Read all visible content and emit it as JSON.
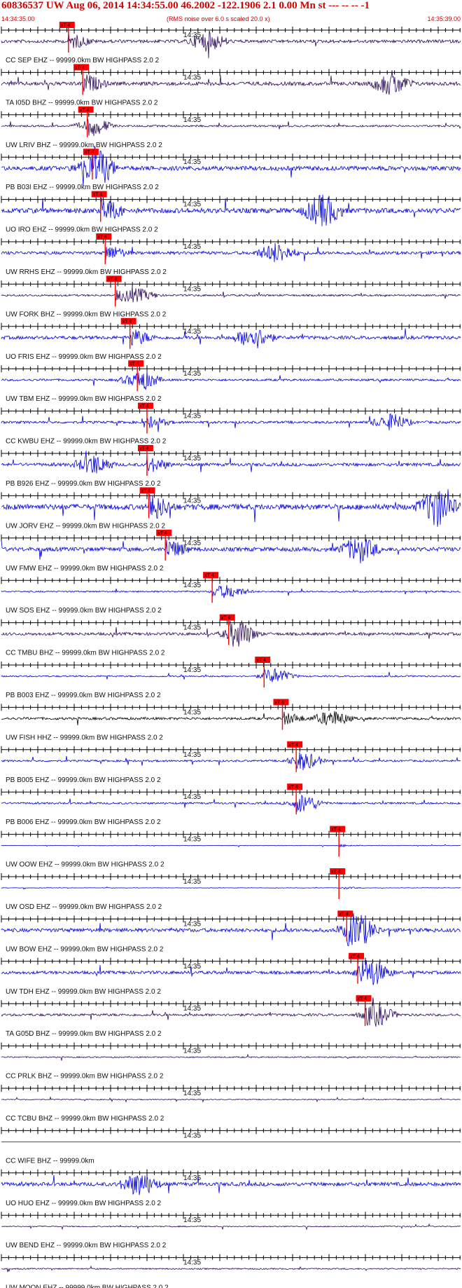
{
  "header": {
    "title": "60836537 UW Aug 06, 2014 14:34:55.00   46.2002 -122.1906  2.1 0.00 Mn st --- -- --  -1",
    "start_time": "14:34:35.00",
    "scale_note": "(RMS noise over 6.0 s scaled 20.0 x)",
    "end_time": "14:35:39.00"
  },
  "colors": {
    "header_red": "#d40000",
    "trace_blue": "#0000e0",
    "trace_dark": "#2a0a5a",
    "trace_black": "#000000",
    "pick_red": "#ff0000",
    "axis_black": "#000000"
  },
  "time_label": "14:35",
  "pick_label": "xT 4",
  "traces": [
    {
      "label": "CC SEP EHZ -- 99999.0km BW  HIGHPASS  2.0  2",
      "color": "dark",
      "pick": 0.146,
      "burst": 0.45,
      "amp": 1.0
    },
    {
      "label": "TA I05D BHZ -- 99999.0km BW  HIGHPASS  2.0  2",
      "color": "dark",
      "pick": 0.177,
      "burst": 0.85,
      "amp": 1.2
    },
    {
      "label": "UW LRIV BHZ -- 99999.0km BW  HIGHPASS  2.0  2",
      "color": "dark",
      "pick": 0.187,
      "burst": 0.2,
      "amp": 0.6
    },
    {
      "label": "PB B03I EHZ -- 99999.0km BW  HIGHPASS  2.0  2",
      "color": "blue",
      "pick": 0.198,
      "burst": 0.2,
      "amp": 1.4
    },
    {
      "label": "UO IRO EHZ -- 99999.0km BW  HIGHPASS  2.0  2",
      "color": "blue",
      "pick": 0.216,
      "burst": 0.7,
      "amp": 1.6
    },
    {
      "label": "UW RRHS EHZ -- 99999.0km BW  HIGHPASS  2.0  2",
      "color": "blue",
      "pick": 0.226,
      "burst": 0.6,
      "amp": 1.0
    },
    {
      "label": "UW FORK BHZ -- 99999.0km BW  HIGHPASS  2.0  2",
      "color": "dark",
      "pick": 0.248,
      "burst": 0.3,
      "amp": 0.6
    },
    {
      "label": "UO FRIS EHZ -- 99999.0km BW  HIGHPASS  2.0  2",
      "color": "blue",
      "pick": 0.28,
      "burst": 0.55,
      "amp": 1.1
    },
    {
      "label": "UW TBM EHZ -- 99999.0km BW  HIGHPASS  2.0  2",
      "color": "blue",
      "pick": 0.296,
      "burst": 0.3,
      "amp": 0.7
    },
    {
      "label": "CC KWBU EHZ -- 99999.0km BW  HIGHPASS  2.0  2",
      "color": "blue",
      "pick": 0.317,
      "burst": 0.85,
      "amp": 0.8
    },
    {
      "label": "PB B926 EHZ -- 99999.0km BW  HIGHPASS  2.0  2",
      "color": "blue",
      "pick": 0.317,
      "burst": 0.2,
      "amp": 1.0
    },
    {
      "label": "UW JORV EHZ -- 99999.0km BW  HIGHPASS  2.0  2",
      "color": "blue",
      "pick": 0.321,
      "burst": 0.95,
      "amp": 1.8
    },
    {
      "label": "UW FMW EHZ -- 99999.0km BW  HIGHPASS  2.0  2",
      "color": "blue",
      "pick": 0.357,
      "burst": 0.78,
      "amp": 1.3
    },
    {
      "label": "UW SOS EHZ -- 99999.0km BW  HIGHPASS  2.0  2",
      "color": "blue",
      "pick": 0.459,
      "burst": 0.5,
      "amp": 0.5
    },
    {
      "label": "CC TMBU BHZ -- 99999.0km BW  HIGHPASS  2.0  2",
      "color": "dark",
      "pick": 0.495,
      "burst": 0.52,
      "amp": 0.9
    },
    {
      "label": "PB B003 EHZ -- 99999.0km BW  HIGHPASS  2.0  2",
      "color": "blue",
      "pick": 0.572,
      "burst": 0.6,
      "amp": 0.5
    },
    {
      "label": "UW FISH HHZ -- 99999.0km BW  HIGHPASS  2.0  2",
      "color": "black",
      "pick": 0.612,
      "burst": 0.72,
      "amp": 0.8
    },
    {
      "label": "PB B005 EHZ -- 99999.0km BW  HIGHPASS  2.0  2",
      "color": "blue",
      "pick": 0.642,
      "burst": 0.66,
      "amp": 0.6
    },
    {
      "label": "PB B006 EHZ -- 99999.0km BW  HIGHPASS  2.0  2",
      "color": "blue",
      "pick": 0.642,
      "burst": 0.66,
      "amp": 0.6
    },
    {
      "label": "UW OOW EHZ -- 99999.0km BW  HIGHPASS  2.0  2",
      "color": "blue",
      "pick": 0.735,
      "burst": 0.0,
      "amp": 0.15
    },
    {
      "label": "UW OSD EHZ -- 99999.0km BW  HIGHPASS  2.0  2",
      "color": "blue",
      "pick": 0.735,
      "burst": 0.0,
      "amp": 0.15
    },
    {
      "label": "UW BOW EHZ -- 99999.0km BW  HIGHPASS  2.0  2",
      "color": "blue",
      "pick": 0.752,
      "burst": 0.78,
      "amp": 1.2
    },
    {
      "label": "UW TDH EHZ -- 99999.0km BW  HIGHPASS  2.0  2",
      "color": "blue",
      "pick": 0.776,
      "burst": 0.81,
      "amp": 1.0
    },
    {
      "label": "TA G05D BHZ -- 99999.0km BW  HIGHPASS  2.0  2",
      "color": "dark",
      "pick": 0.792,
      "burst": 0.82,
      "amp": 0.8
    },
    {
      "label": "CC PRLK BHZ -- 99999.0km BW  HIGHPASS  2.0  2",
      "color": "dark",
      "pick": null,
      "burst": 0.0,
      "amp": 0.4
    },
    {
      "label": "CC TCBU BHZ -- 99999.0km BW  HIGHPASS  2.0  2",
      "color": "dark",
      "pick": null,
      "burst": 0.0,
      "amp": 0.3
    },
    {
      "label": "CC WIFE BHZ -- 99999.0km",
      "color": "blue",
      "pick": null,
      "burst": 0.0,
      "amp": 0.0
    },
    {
      "label": "UO HUO EHZ -- 99999.0km BW  HIGHPASS  2.0  2",
      "color": "blue",
      "pick": null,
      "burst": 0.3,
      "amp": 1.2
    },
    {
      "label": "UW BEND EHZ -- 99999.0km BW  HIGHPASS  2.0  2",
      "color": "dark",
      "pick": null,
      "burst": 0.0,
      "amp": 0.35
    },
    {
      "label": "UW MOON EHZ -- 99999.0km BW  HIGHPASS  2.0  2",
      "color": "dark",
      "pick": null,
      "burst": 0.0,
      "amp": 0.4
    }
  ]
}
